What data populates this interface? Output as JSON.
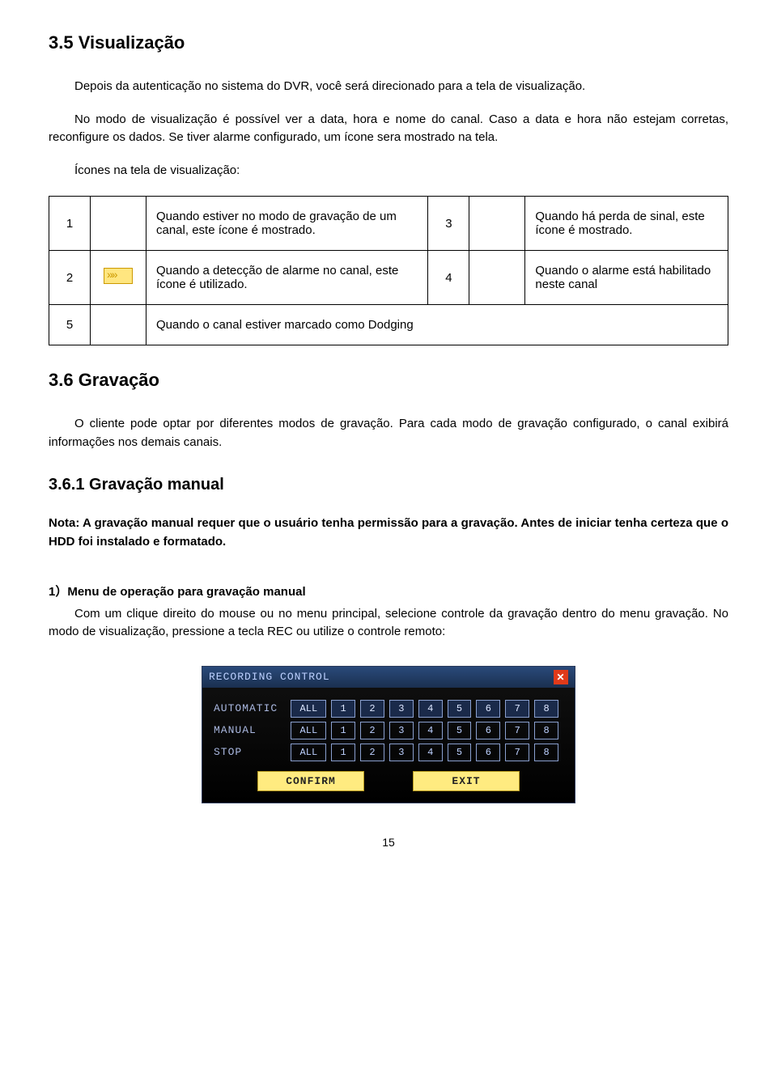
{
  "section35": {
    "heading": "3.5 Visualização",
    "p1": "Depois da autenticação no sistema do DVR, você será direcionado para a tela de visualização.",
    "p2": "No modo de visualização é possível ver a data, hora e nome do canal. Caso a data e hora não estejam corretas, reconfigure os dados. Se tiver alarme configurado, um ícone sera mostrado na tela.",
    "p3": "Ícones na tela de visualização:"
  },
  "iconTable": {
    "r1": {
      "n": "1",
      "desc": "Quando estiver no modo de gravação de um canal, este ícone é mostrado."
    },
    "r3": {
      "n": "3",
      "desc": "Quando há perda de sinal, este ícone é mostrado."
    },
    "r2": {
      "n": "2",
      "desc": "Quando a detecção de alarme no canal, este ícone é utilizado."
    },
    "r4": {
      "n": "4",
      "desc": "Quando o alarme está habilitado neste canal"
    },
    "r5": {
      "n": "5",
      "desc": "Quando o canal estiver marcado como Dodging"
    }
  },
  "section36": {
    "heading": "3.6 Gravação",
    "p1": "O cliente pode optar por diferentes modos de gravação. Para cada modo de gravação configurado, o canal exibirá informações nos demais canais."
  },
  "section361": {
    "heading": "3.6.1 Gravação manual",
    "note": "Nota: A gravação manual requer que o usuário tenha permissão para a gravação. Antes de iniciar tenha certeza que o HDD foi instalado e formatado.",
    "step_title": "1）Menu de operação para gravação manual",
    "step_body": "Com um clique direito do mouse ou no menu principal, selecione controle da gravação dentro do menu gravação. No modo de visualização, pressione a tecla REC ou utilize o controle remoto:"
  },
  "dvr": {
    "title": "RECORDING CONTROL",
    "rows": {
      "automatic": "AUTOMATIC",
      "manual": "MANUAL",
      "stop": "STOP"
    },
    "all": "ALL",
    "channels": [
      "1",
      "2",
      "3",
      "4",
      "5",
      "6",
      "7",
      "8"
    ],
    "confirm": "CONFIRM",
    "exit": "EXIT"
  },
  "pageNumber": "15"
}
